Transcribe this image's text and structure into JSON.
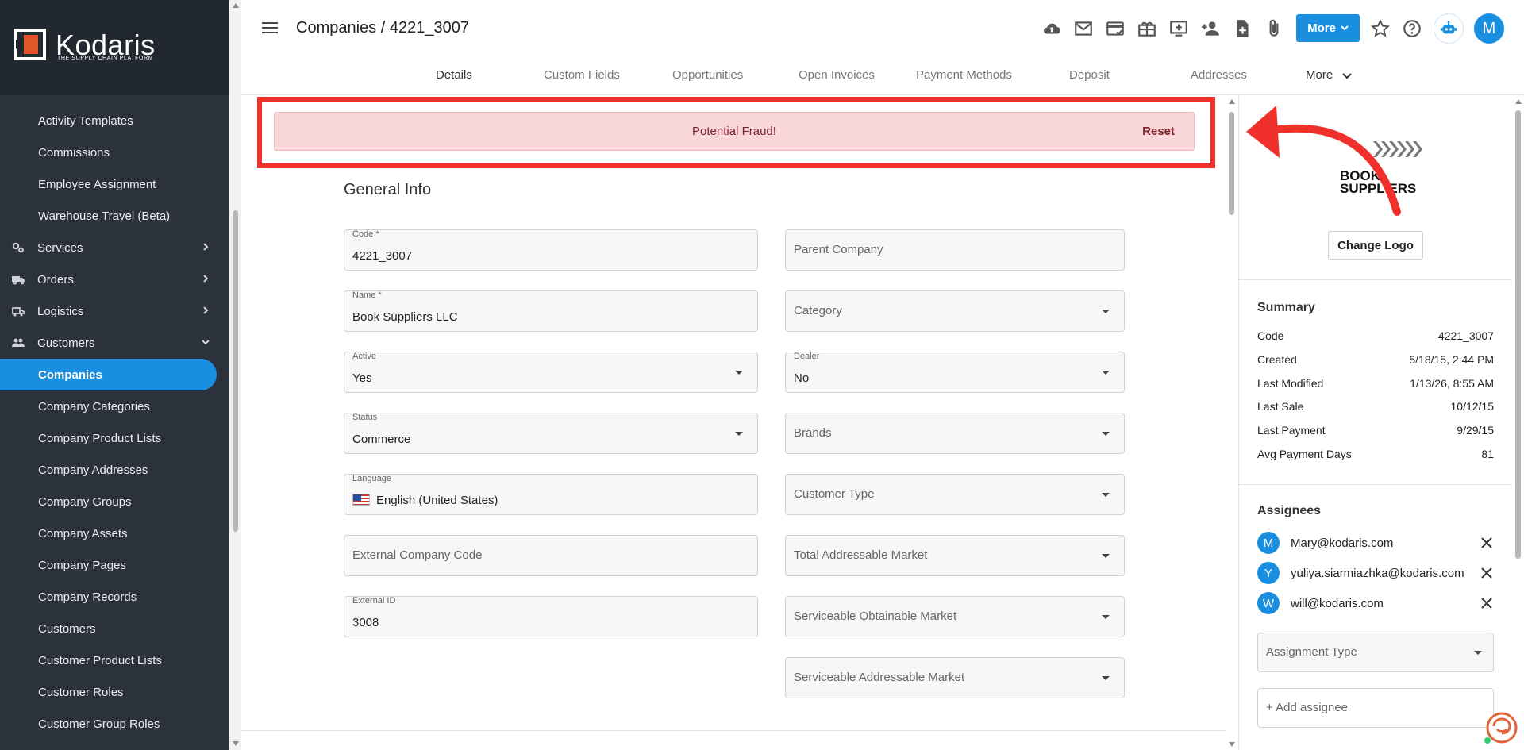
{
  "app": {
    "brand": "Kodaris",
    "brand_tagline": "THE SUPPLY CHAIN PLATFORM",
    "accent_color": "#1a8fdf",
    "alert_border_color": "#f0302b"
  },
  "sidebar": {
    "items": [
      {
        "label": "Activity Templates",
        "type": "sub"
      },
      {
        "label": "Commissions",
        "type": "sub"
      },
      {
        "label": "Employee Assignment",
        "type": "sub"
      },
      {
        "label": "Warehouse Travel (Beta)",
        "type": "sub"
      },
      {
        "label": "Services",
        "type": "section",
        "icon": "gears-icon"
      },
      {
        "label": "Orders",
        "type": "section",
        "icon": "truck-icon"
      },
      {
        "label": "Logistics",
        "type": "section",
        "icon": "shipping-icon"
      },
      {
        "label": "Customers",
        "type": "section",
        "icon": "people-icon",
        "expanded": true
      },
      {
        "label": "Companies",
        "type": "sub",
        "active": true
      },
      {
        "label": "Company Categories",
        "type": "sub"
      },
      {
        "label": "Company Product Lists",
        "type": "sub"
      },
      {
        "label": "Company Addresses",
        "type": "sub"
      },
      {
        "label": "Company Groups",
        "type": "sub"
      },
      {
        "label": "Company Assets",
        "type": "sub"
      },
      {
        "label": "Company Pages",
        "type": "sub"
      },
      {
        "label": "Company Records",
        "type": "sub"
      },
      {
        "label": "Customers",
        "type": "sub"
      },
      {
        "label": "Customer Product Lists",
        "type": "sub"
      },
      {
        "label": "Customer Roles",
        "type": "sub"
      },
      {
        "label": "Customer Group Roles",
        "type": "sub"
      }
    ]
  },
  "header": {
    "breadcrumb": "Companies / 4221_3007",
    "more_label": "More",
    "avatar_letter": "M",
    "icons": [
      "cloud-upload-icon",
      "mail-icon",
      "payment-card-icon",
      "gift-icon",
      "add-screen-icon",
      "add-person-icon",
      "add-document-icon",
      "attachment-icon"
    ]
  },
  "tabs": {
    "items": [
      "Details",
      "Custom Fields",
      "Opportunities",
      "Open Invoices",
      "Payment Methods",
      "Deposit",
      "Addresses"
    ],
    "active": "Details",
    "more_label": "More"
  },
  "alert": {
    "message": "Potential Fraud!",
    "action": "Reset"
  },
  "general_info": {
    "title": "General Info",
    "left_fields": [
      {
        "label": "Code *",
        "value": "4221_3007"
      },
      {
        "label": "Name *",
        "value": "Book Suppliers LLC"
      },
      {
        "label": "Active",
        "value": "Yes",
        "dropdown": true
      },
      {
        "label": "Status",
        "value": "Commerce",
        "dropdown": true
      },
      {
        "label": "Language",
        "value": "English (United States)"
      },
      {
        "placeholder": "External Company Code"
      },
      {
        "label": "External ID",
        "value": "3008"
      }
    ],
    "right_fields": [
      {
        "placeholder": "Parent Company"
      },
      {
        "placeholder": "Category",
        "dropdown": true
      },
      {
        "label": "Dealer",
        "value": "No",
        "dropdown": true
      },
      {
        "placeholder": "Brands",
        "dropdown": true
      },
      {
        "placeholder": "Customer Type",
        "dropdown": true
      },
      {
        "placeholder": "Total Addressable Market",
        "dropdown": true
      },
      {
        "placeholder": "Serviceable Obtainable Market",
        "dropdown": true
      },
      {
        "placeholder": "Serviceable Addressable Market",
        "dropdown": true
      }
    ]
  },
  "right_panel": {
    "logo_text_line1": "BOOK",
    "logo_text_line2": "SUPPLIERS",
    "change_logo_label": "Change Logo",
    "summary_title": "Summary",
    "summary": [
      {
        "label": "Code",
        "value": "4221_3007"
      },
      {
        "label": "Created",
        "value": "5/18/15, 2:44 PM"
      },
      {
        "label": "Last Modified",
        "value": "1/13/26, 8:55 AM"
      },
      {
        "label": "Last Sale",
        "value": "10/12/15"
      },
      {
        "label": "Last Payment",
        "value": "9/29/15"
      },
      {
        "label": "Avg Payment Days",
        "value": "81"
      }
    ],
    "assignees_title": "Assignees",
    "assignees": [
      {
        "initial": "M",
        "email": "Mary@kodaris.com"
      },
      {
        "initial": "Y",
        "email": "yuliya.siarmiazhka@kodaris.com"
      },
      {
        "initial": "W",
        "email": "will@kodaris.com"
      }
    ],
    "assignment_type_placeholder": "Assignment Type",
    "add_assignee_placeholder": "+ Add assignee"
  }
}
